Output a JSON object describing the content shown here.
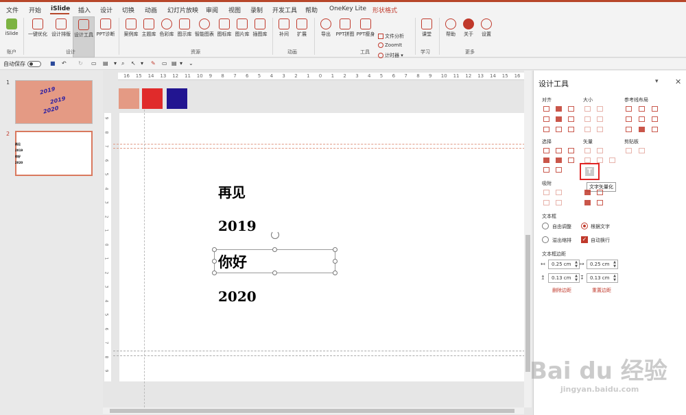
{
  "tabs": [
    "文件",
    "开始",
    "iSlide",
    "插入",
    "设计",
    "切换",
    "动画",
    "幻灯片放映",
    "审阅",
    "视图",
    "录制",
    "开发工具",
    "帮助",
    "OneKey Lite",
    "形状格式"
  ],
  "ribbon": {
    "account": {
      "islide": "iSlide",
      "group": "账户"
    },
    "design": {
      "onekey": "一键优化",
      "layout": "设计排版",
      "tools": "设计工具",
      "diagnose": "PPT诊断",
      "group": "设计"
    },
    "resources": {
      "items": [
        "案例库",
        "主题库",
        "色彩库",
        "图示库",
        "智能图表",
        "图标库",
        "图片库",
        "插图库"
      ],
      "group": "资源"
    },
    "animation": {
      "items": [
        "补间",
        "扩展"
      ],
      "group": "动画"
    },
    "tools": {
      "export": "导出",
      "puzzle": "PPT拼图",
      "slim": "PPT瘦身",
      "file_analysis": "文件分析",
      "zoomit": "ZoomIt",
      "timer": "计时器",
      "group": "工具"
    },
    "learn": {
      "classroom": "课堂",
      "group": "学习"
    },
    "more": {
      "help": "帮助",
      "about": "关于",
      "settings": "设置",
      "group": "更多"
    }
  },
  "qat": {
    "autosave": "自动保存"
  },
  "thumbnails": [
    {
      "num": "1",
      "lines": [
        "2019",
        "2019",
        "2020"
      ]
    },
    {
      "num": "2",
      "lines": [
        "再见",
        "2019",
        "你好",
        "2020"
      ]
    }
  ],
  "ruler_h": [
    "16",
    "15",
    "14",
    "13",
    "12",
    "11",
    "10",
    "9",
    "8",
    "7",
    "6",
    "5",
    "4",
    "3",
    "2",
    "1",
    "0",
    "1",
    "2",
    "3",
    "4",
    "5",
    "6",
    "7",
    "8",
    "9",
    "10",
    "11",
    "12",
    "13",
    "14",
    "15",
    "16"
  ],
  "ruler_v": [
    "9",
    "8",
    "7",
    "6",
    "5",
    "4",
    "3",
    "2",
    "1",
    "0",
    "1",
    "2",
    "3",
    "4",
    "5",
    "6",
    "7",
    "8",
    "9"
  ],
  "swatches": [
    "#e49a84",
    "#e02b2b",
    "#221591"
  ],
  "slide": {
    "lines": [
      "再见",
      "2019",
      "你好",
      "2020"
    ]
  },
  "panel": {
    "title": "设计工具",
    "sections": {
      "align": "对齐",
      "size": "大小",
      "guides": "参考线布局",
      "select": "选择",
      "vector": "矢量",
      "clipboard": "剪贴板",
      "snap": "吸附",
      "textbox": "文本框",
      "margins": "文本框边距"
    },
    "tooltip": "文字矢量化",
    "options": {
      "free": "自由调整",
      "fit": "根据文字",
      "overflow": "溢出缩排",
      "wrap": "自动换行"
    },
    "margins": {
      "left": "0.25 cm",
      "right": "0.25 cm",
      "top": "0.13 cm",
      "bottom": "0.13 cm"
    },
    "links": {
      "delete": "删除边距",
      "reset": "重置边距"
    }
  },
  "watermark": {
    "main": "Bai du 经验",
    "sub": "jingyan.baidu.com"
  }
}
